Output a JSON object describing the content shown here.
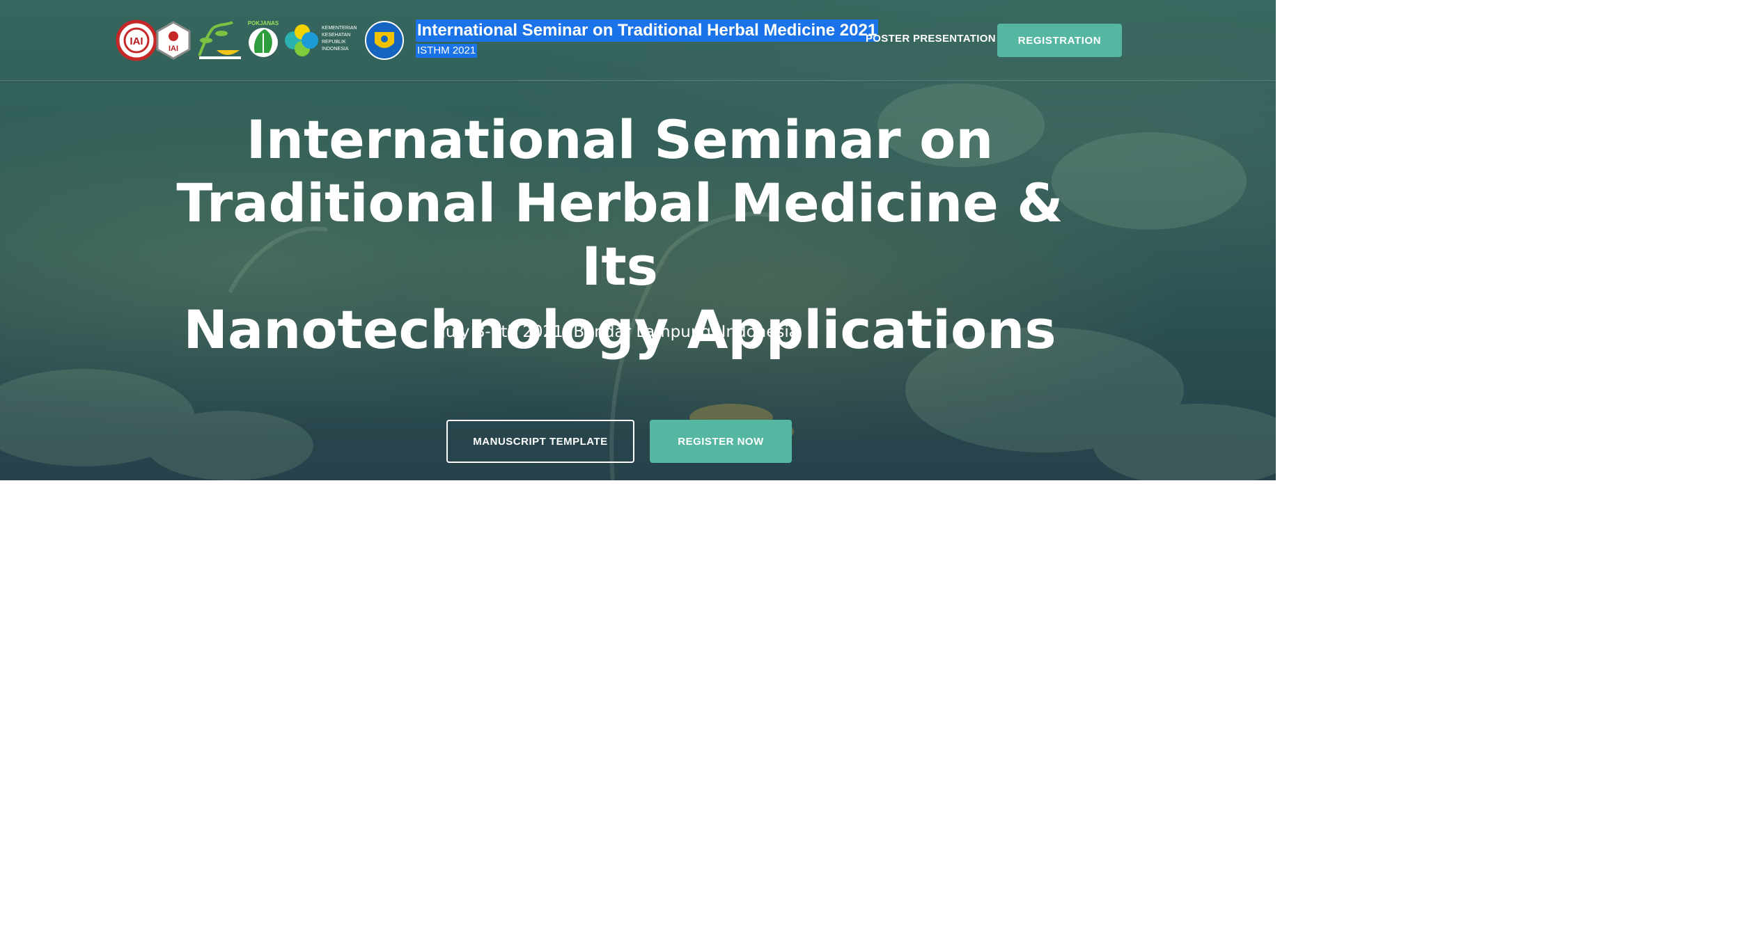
{
  "header": {
    "brand_title": "International Seminar on Traditional Herbal Medicine 2021",
    "brand_subtitle": "ISTHM 2021",
    "nav_poster": "POSTER PRESENTATION",
    "nav_registration": "REGISTRATION",
    "logos": [
      {
        "icon": "institution-seal-logo",
        "text": "IAI"
      },
      {
        "icon": "hexagon-badge-logo",
        "text": "IAI"
      },
      {
        "icon": "plant-mortar-logo",
        "text": ""
      },
      {
        "icon": "green-leaf-emblem-logo",
        "text": "POKJANAS"
      },
      {
        "icon": "ministry-of-health-logo",
        "text": "KEMENTERIAN KESEHATAN REPUBLIK INDONESIA"
      },
      {
        "icon": "university-shield-logo",
        "text": ""
      }
    ]
  },
  "hero": {
    "title_line1": "International Seminar on",
    "title_line2": "Traditional Herbal Medicine & Its",
    "title_line3": "Nanotechnology Applications",
    "date_location": "July 8-9th 2021, Bandar Lampung, Indonesia",
    "btn_manuscript": "MANUSCRIPT TEMPLATE",
    "btn_register": "REGISTER NOW"
  },
  "colors": {
    "accent": "#55b7a2",
    "selection_highlight": "#1a73e8",
    "hero_bg_top": "#36675e",
    "hero_bg_bottom": "#26414a"
  }
}
